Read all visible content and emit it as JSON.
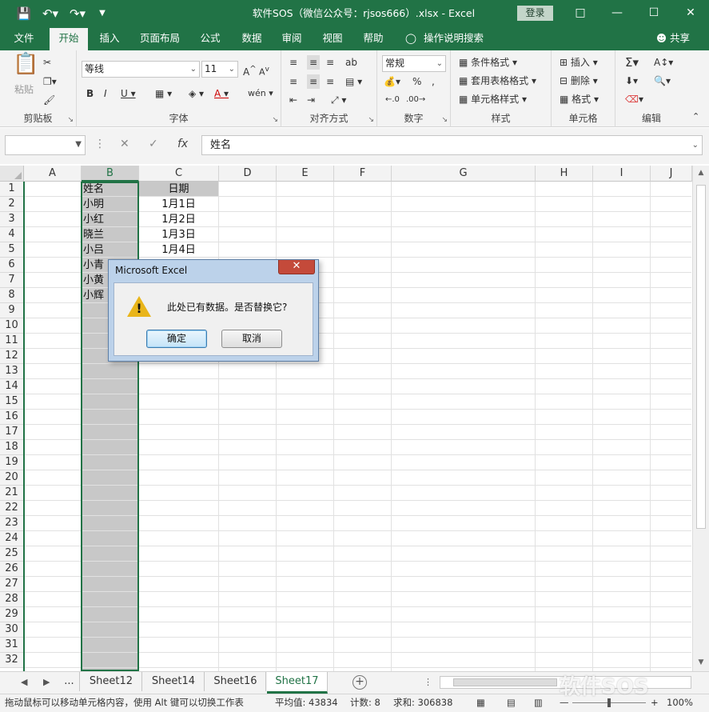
{
  "window": {
    "title": "软件SOS（微信公众号：rjsos666）.xlsx  -  Excel",
    "login_label": "登录"
  },
  "tabs": [
    "文件",
    "开始",
    "插入",
    "页面布局",
    "公式",
    "数据",
    "审阅",
    "视图",
    "帮助"
  ],
  "tell_me": "操作说明搜索",
  "share": "共享",
  "ribbon": {
    "clipboard": {
      "label": "剪贴板",
      "paste": "粘贴"
    },
    "font": {
      "label": "字体",
      "name": "等线",
      "size": "11"
    },
    "alignment": {
      "label": "对齐方式"
    },
    "number": {
      "label": "数字",
      "format": "常规"
    },
    "styles": {
      "label": "样式",
      "conditional": "条件格式",
      "table": "套用表格格式",
      "cell": "单元格样式"
    },
    "cells": {
      "label": "单元格",
      "insert": "插入",
      "delete": "删除",
      "format": "格式"
    },
    "editing": {
      "label": "编辑"
    }
  },
  "formula_bar": {
    "name_box": "",
    "value": "姓名"
  },
  "grid": {
    "columns": [
      "A",
      "B",
      "C",
      "D",
      "E",
      "F",
      "G",
      "H",
      "I",
      "J"
    ],
    "rows": [
      "1",
      "2",
      "3",
      "4",
      "5",
      "6",
      "7",
      "8",
      "9",
      "10",
      "11",
      "12",
      "13",
      "14",
      "15",
      "16",
      "17",
      "18",
      "19",
      "20",
      "21",
      "22",
      "23",
      "24",
      "25",
      "26",
      "27",
      "28",
      "29",
      "30",
      "31",
      "32"
    ],
    "names": [
      "姓名",
      "小明",
      "小红",
      "晓兰",
      "小吕",
      "小青",
      "小黄",
      "小辉"
    ],
    "dates": [
      "日期",
      "1月1日",
      "1月2日",
      "1月3日",
      "1月4日"
    ]
  },
  "sheets": [
    "...",
    "Sheet12",
    "Sheet14",
    "Sheet16",
    "Sheet17"
  ],
  "status": {
    "message": "拖动鼠标可以移动单元格内容，使用 Alt 键可以切换工作表",
    "average": "平均值: 43834",
    "count": "计数: 8",
    "sum": "求和: 306838",
    "zoom": "100%"
  },
  "dialog": {
    "title": "Microsoft Excel",
    "message": "此处已有数据。是否替换它?",
    "ok": "确定",
    "cancel": "取消"
  },
  "watermark": "软件SOS"
}
